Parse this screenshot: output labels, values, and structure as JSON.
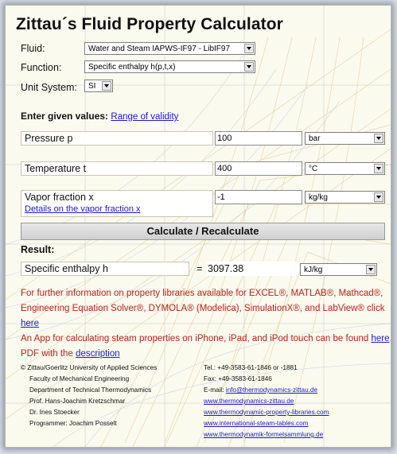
{
  "title": "Zittau´s Fluid Property Calculator",
  "fluid": {
    "label": "Fluid:",
    "value": "Water and Steam IAPWS-IF97 - LibIF97"
  },
  "function": {
    "label": "Function:",
    "value": "Specific enthalpy h(p,t,x)"
  },
  "unit_system": {
    "label": "Unit System:",
    "value": "SI"
  },
  "given": {
    "heading": "Enter given values:",
    "range_link": "Range of validity"
  },
  "inputs": [
    {
      "label": "Pressure p",
      "value": "100",
      "unit": "bar"
    },
    {
      "label": "Temperature t",
      "value": "400",
      "unit": "°C"
    },
    {
      "label": "Vapor fraction x",
      "value": "-1",
      "unit": "kg/kg",
      "link": "Details on the vapor fraction x"
    }
  ],
  "calculate_button": "Calculate / Recalculate",
  "result": {
    "heading": "Result:",
    "label": "Specific enthalpy h",
    "equals": "=",
    "value": "3097.38",
    "unit": "kJ/kg"
  },
  "info": {
    "line1": "For further information on property libraries available for EXCEL®, MATLAB®, Mathcad®,",
    "line2": "Engineering Equation Solver®, DYMOLA® (Modelica), SimulationX®, and LabView® click",
    "here_link": "here",
    "line3_pre": "An App for calculating steam properties on iPhone, iPad, and iPod touch can be found ",
    "line3_link": "here",
    "line3_post": ".",
    "line4_pre": "PDF with the ",
    "line4_link": "description"
  },
  "footer": {
    "left": [
      "© Zittau/Goerlitz University of Applied Sciences",
      "Faculty of Mechanical Engineering",
      "Department of Technical Thermodynamics",
      "Prof. Hans-Joachim Kretzschmar",
      "Dr. Ines Stoecker",
      "Programmer: Joachim Posselt"
    ],
    "tel": "Tel.: +49-3583-61-1846 or -1881",
    "fax": "Fax: +49-3583-61-1846",
    "email_label": "E-mail: ",
    "email_link": "info@thermodynamics-zittau.de",
    "links": [
      "www.thermodynamics-zittau.de",
      "www.thermodynamic-property-libraries.com",
      "www.international-steam-tables.com",
      "www.thermodynamik-formelsammlung.de"
    ]
  }
}
